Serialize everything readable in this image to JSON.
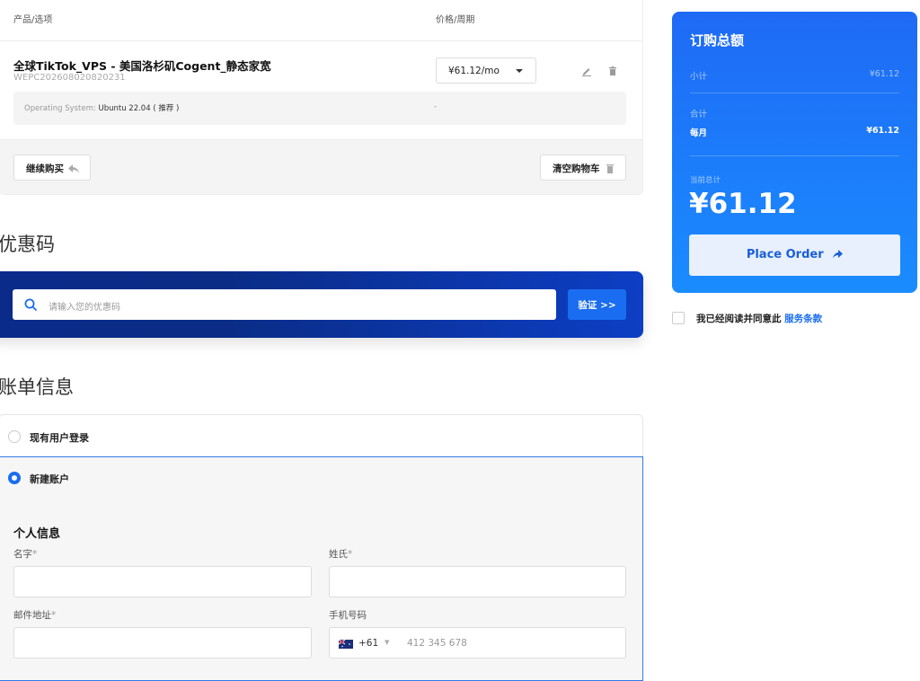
{
  "cart": {
    "col_product": "产品/选项",
    "col_price": "价格/周期",
    "item": {
      "name": "全球TikTok_VPS - 美国洛杉矶Cogent_静态家宽",
      "code": "WEPC202608020820231",
      "price": "¥61.12/mo",
      "option_label": "Operating System:",
      "option_value": "Ubuntu 22.04 ( 推荐 )",
      "option_price": "-"
    },
    "continue_label": "继续购买",
    "clear_label": "清空购物车"
  },
  "promo": {
    "section_title": "优惠码",
    "placeholder": "请输入您的优惠码",
    "validate_label": "验证 >>"
  },
  "billing": {
    "section_title": "账单信息",
    "existing_user": "现有用户登录",
    "new_account": "新建账户",
    "personal_info": "个人信息",
    "first_name": "名字",
    "last_name": "姓氏",
    "email": "邮件地址",
    "phone": "手机号码",
    "required_mark": "*",
    "phone_code": "+61",
    "phone_placeholder": "412 345 678"
  },
  "summary": {
    "title": "订购总额",
    "subtotal_label": "小计",
    "subtotal_value": "¥61.12",
    "total_label": "合计",
    "monthly_label": "每月",
    "monthly_value": "¥61.12",
    "due_label": "当前总计",
    "due_value": "¥61.12",
    "place_order": "Place Order"
  },
  "tos": {
    "text": "我已经阅读并同意此",
    "link": "服务条款"
  },
  "colors": {
    "accent": "#1a6df0",
    "summary_gradient_top": "#1f6af5",
    "summary_gradient_bottom": "#1a8cff",
    "promo_bg": "#0a2b8a"
  }
}
